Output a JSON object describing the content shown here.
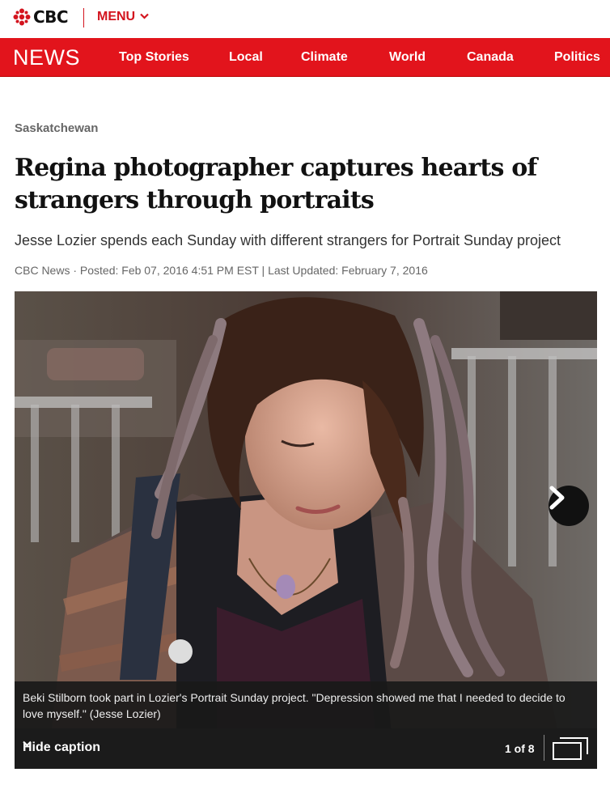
{
  "header": {
    "brand": "CBC",
    "menu_label": "MENU",
    "brand_color": "#d3141e"
  },
  "nav": {
    "section": "NEWS",
    "items": [
      "Top Stories",
      "Local",
      "Climate",
      "World",
      "Canada",
      "Politics"
    ],
    "bg_color": "#e2141c"
  },
  "article": {
    "section_label": "Saskatchewan",
    "headline": "Regina photographer captures hearts of strangers through portraits",
    "deck": "Jesse Lozier spends each Sunday with different strangers for Portrait Sunday project",
    "byline": "CBC News · Posted: Feb 07, 2016 4:51 PM EST | Last Updated: February 7, 2016"
  },
  "gallery": {
    "caption": "Beki Stilborn took part in Lozier's Portrait Sunday project. \"Depression showed me that I needed to decide to love myself.\" (Jesse Lozier)",
    "hide_caption_label": "Hide caption",
    "counter": "1 of 8",
    "icons": [
      "next-arrow-icon",
      "expand-icon",
      "chevron-down-icon"
    ]
  }
}
